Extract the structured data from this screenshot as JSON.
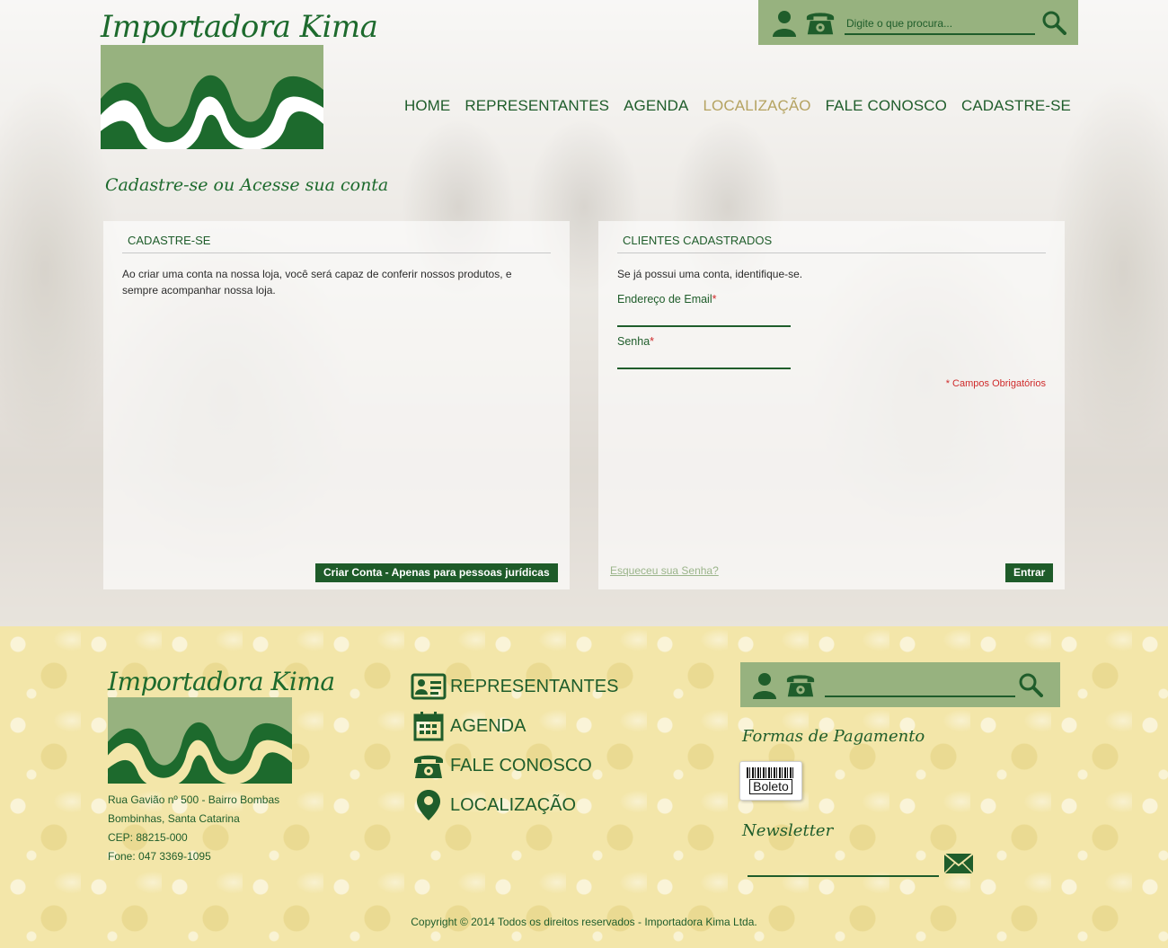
{
  "brand": {
    "name": "Importadora Kima",
    "tagline": "Cadastre-se ou Acesse sua conta"
  },
  "header": {
    "search_placeholder": "Digite o que procura...",
    "nav": [
      {
        "label": "HOME"
      },
      {
        "label": "REPRESENTANTES"
      },
      {
        "label": "AGENDA"
      },
      {
        "label": "LOCALIZAÇÃO"
      },
      {
        "label": "FALE CONOSCO"
      },
      {
        "label": "CADASTRE-SE"
      }
    ],
    "active_nav": "LOCALIZAÇÃO"
  },
  "register_panel": {
    "title": "CADASTRE-SE",
    "description": "Ao criar uma conta na nossa loja, você será capaz de conferir nossos produtos, e sempre acompanhar nossa loja.",
    "create_button": "Criar Conta - Apenas para pessoas jurídicas"
  },
  "login_panel": {
    "title": "CLIENTES CADASTRADOS",
    "description": "Se já possui uma conta, identifique-se.",
    "email_label": "Endereço de Email",
    "password_label": "Senha",
    "required_marker": "*",
    "required_note": "* Campos Obrigatórios",
    "forgot_link": "Esqueceu sua Senha?",
    "login_button": "Entrar"
  },
  "footer": {
    "address_lines": [
      "Rua Gavião nº 500 - Bairro Bombas",
      "Bombinhas, Santa Catarina",
      "CEP: 88215-000",
      "Fone: 047 3369-1095"
    ],
    "nav": [
      {
        "label": "REPRESENTANTES",
        "icon": "id-card-icon"
      },
      {
        "label": "AGENDA",
        "icon": "calendar-icon"
      },
      {
        "label": "FALE CONOSCO",
        "icon": "phone-icon"
      },
      {
        "label": "LOCALIZAÇÃO",
        "icon": "map-pin-icon"
      }
    ],
    "payment_heading": "Formas de Pagamento",
    "payment_method": "Boleto",
    "newsletter_heading": "Newsletter",
    "copyright": "Copyright © 2014 Todos os direitos reservados - Importadora Kima Ltda."
  },
  "colors": {
    "brand_green": "#1d6a2d",
    "light_green": "#97b27f",
    "active_gold": "#b5a361",
    "required_red": "#cf2b2b",
    "footer_yellow": "#f3e6a9"
  }
}
